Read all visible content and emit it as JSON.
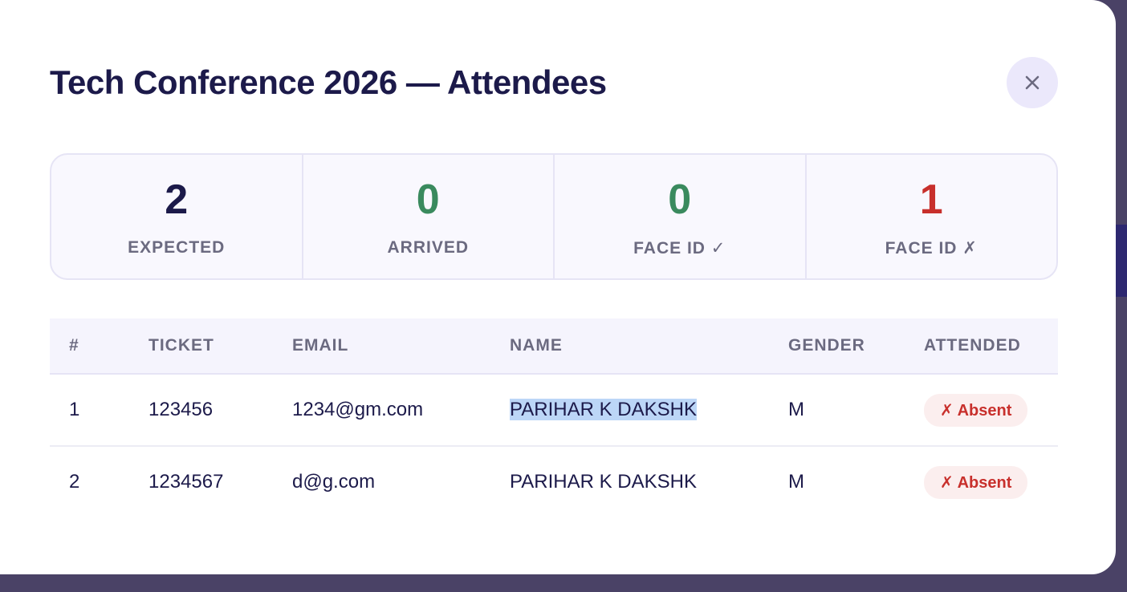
{
  "modal": {
    "title": "Tech Conference 2026 — Attendees",
    "close_label": "×"
  },
  "stats": [
    {
      "value": "2",
      "label": "EXPECTED",
      "color": "#1c1a4a"
    },
    {
      "value": "0",
      "label": "ARRIVED",
      "color": "#3a8a5e"
    },
    {
      "value": "0",
      "label": "FACE ID ✓",
      "color": "#3a8a5e"
    },
    {
      "value": "1",
      "label": "FACE ID ✗",
      "color": "#c8302c"
    }
  ],
  "table": {
    "headers": [
      "#",
      "TICKET",
      "EMAIL",
      "NAME",
      "GENDER",
      "ATTENDED"
    ],
    "rows": [
      {
        "num": "1",
        "ticket": "123456",
        "email": "1234@gm.com",
        "name": "PARIHAR K DAKSHK",
        "gender": "M",
        "attended": "✗ Absent"
      },
      {
        "num": "2",
        "ticket": "1234567",
        "email": "d@g.com",
        "name": "PARIHAR K DAKSHK",
        "gender": "M",
        "attended": "✗ Absent"
      }
    ]
  },
  "colors": {
    "title": "#1c1a4a",
    "accent_green": "#3a8a5e",
    "accent_red": "#c8302c",
    "badge_bg": "#fbeeee"
  }
}
